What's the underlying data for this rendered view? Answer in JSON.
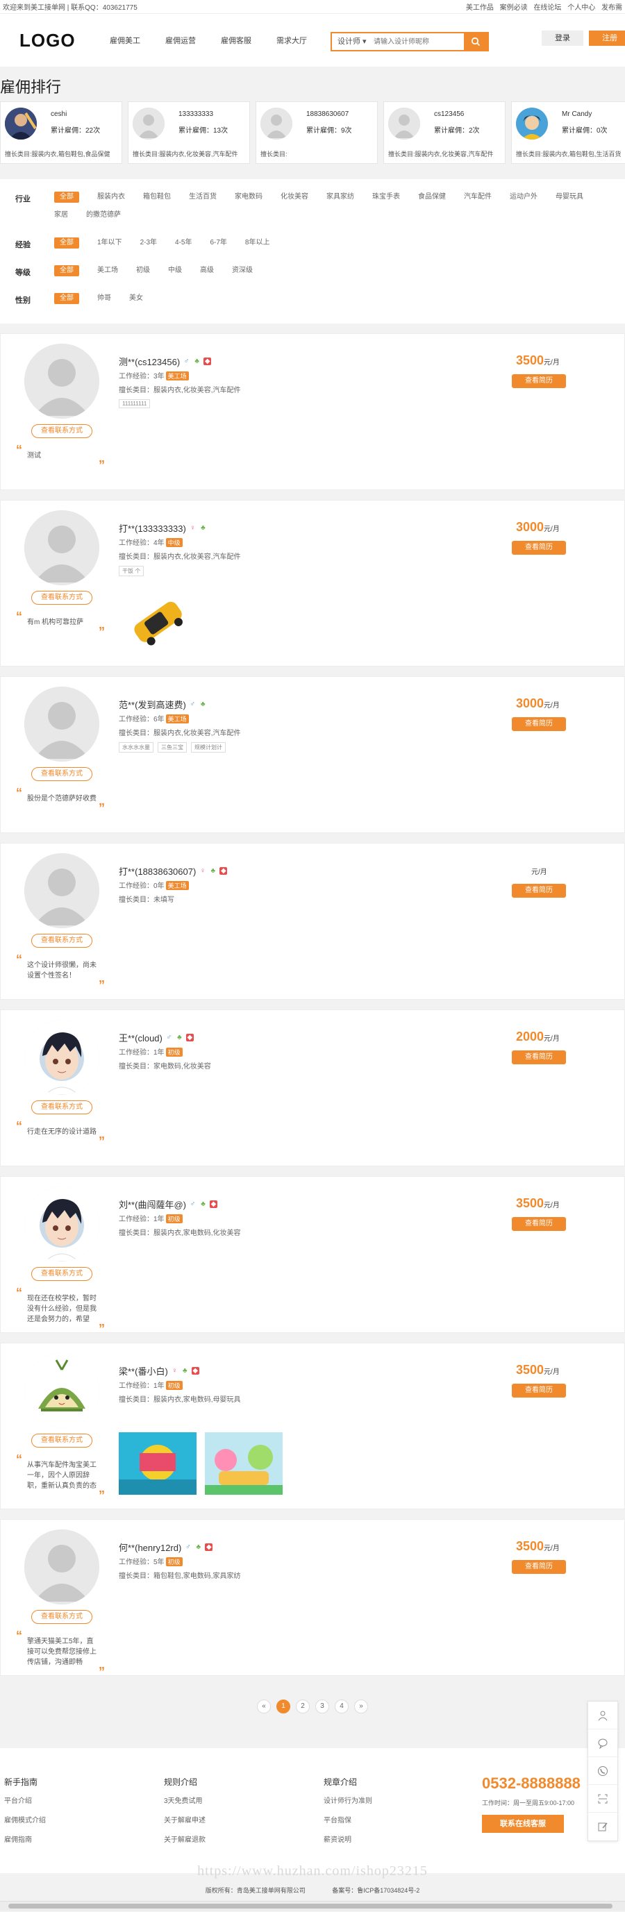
{
  "topbar": {
    "welcome": "欢迎来到美工接单网 | 联系QQ：403621775",
    "links": [
      "美工作品",
      "案例必读",
      "在线论坛",
      "个人中心",
      "发布需"
    ]
  },
  "header": {
    "logo": "LOGO",
    "nav": [
      "雇佣美工",
      "雇佣运营",
      "雇佣客服",
      "需求大厅"
    ],
    "search_type": "设计师 ▾",
    "search_placeholder": "请输入设计师昵称",
    "login": "登录",
    "register": "注册"
  },
  "section_title": "雇佣排行",
  "top_hires": [
    {
      "name": "ceshi",
      "count": "累计雇佣：22次",
      "category": "擅长类目:服装内衣,箱包鞋包,食品保健"
    },
    {
      "name": "133333333",
      "count": "累计雇佣：13次",
      "category": "擅长类目:服装内衣,化妆美容,汽车配件"
    },
    {
      "name": "18838630607",
      "count": "累计雇佣：9次",
      "category": "擅长类目:"
    },
    {
      "name": "cs123456",
      "count": "累计雇佣：2次",
      "category": "擅长类目:服装内衣,化妆美容,汽车配件"
    },
    {
      "name": "Mr Candy",
      "count": "累计雇佣：0次",
      "category": "擅长类目:服装内衣,箱包鞋包,生活百货"
    }
  ],
  "filters": [
    {
      "label": "行业",
      "options": [
        "全部",
        "服装内衣",
        "箱包鞋包",
        "生活百货",
        "家电数码",
        "化妆美容",
        "家具家纺",
        "珠宝手表",
        "食品保健",
        "汽车配件",
        "运动户外",
        "母婴玩具",
        "家居",
        "的撒范德萨"
      ]
    },
    {
      "label": "经验",
      "options": [
        "全部",
        "1年以下",
        "2-3年",
        "4-5年",
        "6-7年",
        "8年以上"
      ]
    },
    {
      "label": "等级",
      "options": [
        "全部",
        "美工场",
        "初级",
        "中级",
        "高级",
        "资深级"
      ]
    },
    {
      "label": "性别",
      "options": [
        "全部",
        "帅哥",
        "美女"
      ]
    }
  ],
  "contact_label": "查看联系方式",
  "view_label": "查看简历",
  "price_unit": "元/月",
  "designers": [
    {
      "name": "测**(cs123456)",
      "gender": "♂",
      "exp": "工作经验：3年",
      "level": "美工场",
      "skill": "擅长类目：服装内衣,化妆美容,汽车配件",
      "tags": [
        "111111111"
      ],
      "price": "3500",
      "quote": "测试"
    },
    {
      "name": "打**(133333333)",
      "gender": "♀",
      "exp": "工作经验：4年",
      "level": "中级",
      "skill": "擅长类目：服装内衣,化妆美容,汽车配件",
      "tags": [
        "干饭 个"
      ],
      "price": "3000",
      "quote": "有m 机构可靠拉萨"
    },
    {
      "name": "范**(发到高速费)",
      "gender": "♂",
      "exp": "工作经验：6年",
      "level": "美工场",
      "skill": "擅长类目：服装内衣,化妆美容,汽车配件",
      "tags": [
        "水水水水量",
        "三鱼三宝",
        "规模计划计"
      ],
      "price": "3000",
      "quote": "股份是个范德萨好收费"
    },
    {
      "name": "打**(18838630607)",
      "gender": "♀",
      "exp": "工作经验：0年",
      "level": "美工场",
      "skill": "擅长类目：未填写",
      "tags": [],
      "price": "",
      "quote": "这个设计师很懒，尚未设置个性签名！"
    },
    {
      "name": "王**(cloud)",
      "gender": "♂",
      "exp": "工作经验：1年",
      "level": "初级",
      "skill": "擅长类目：家电数码,化妆美容",
      "tags": [],
      "price": "2000",
      "quote": "行走在无序的设计道路"
    },
    {
      "name": "刘**(曲闯薩年@)",
      "gender": "♂",
      "exp": "工作经验：1年",
      "level": "初级",
      "skill": "擅长类目：服装内衣,家电数码,化妆美容",
      "tags": [],
      "price": "3500",
      "quote": "现在还在校学校，暂时没有什么经验，但是我还是会努力的，希望"
    },
    {
      "name": "梁**(番小白)",
      "gender": "♀",
      "exp": "工作经验：1年",
      "level": "初级",
      "skill": "擅长类目：服装内衣,家电数码,母婴玩具",
      "tags": [],
      "price": "3500",
      "quote": "从事汽车配件淘宝美工一年，因个人原因辞职，重新认真负责的态"
    },
    {
      "name": "何**(henry12rd)",
      "gender": "♂",
      "exp": "工作经验：5年",
      "level": "初级",
      "skill": "擅长类目：箱包鞋包,家电数码,家具家纺",
      "tags": [],
      "price": "3500",
      "quote": "擎通天猫美工5年，直接可以免费帮您接修上传店铺，沟通即畅"
    }
  ],
  "pager": [
    "«",
    "1",
    "2",
    "3",
    "4",
    "»"
  ],
  "footer": {
    "cols": [
      {
        "title": "新手指南",
        "items": [
          "平台介绍",
          "雇佣模式介绍",
          "雇佣指南"
        ]
      },
      {
        "title": "规则介绍",
        "items": [
          "3天免费试用",
          "关于解雇申述",
          "关于解雇退款"
        ]
      },
      {
        "title": "规章介绍",
        "items": [
          "设计师行为准则",
          "平台指保",
          "薪资说明"
        ]
      }
    ],
    "phone": "0532-8888888",
    "work_time": "工作时间：周一至周五9:00-17:00",
    "online": "联系在线客服"
  },
  "copyright": {
    "owner": "版权所有：青岛美工接单网有限公司",
    "icp": "备案号：鲁ICP备17034824号-2"
  },
  "watermark": "https://www.huzhan.com/ishop23215",
  "colors": {
    "accent": "#f08a2c"
  }
}
